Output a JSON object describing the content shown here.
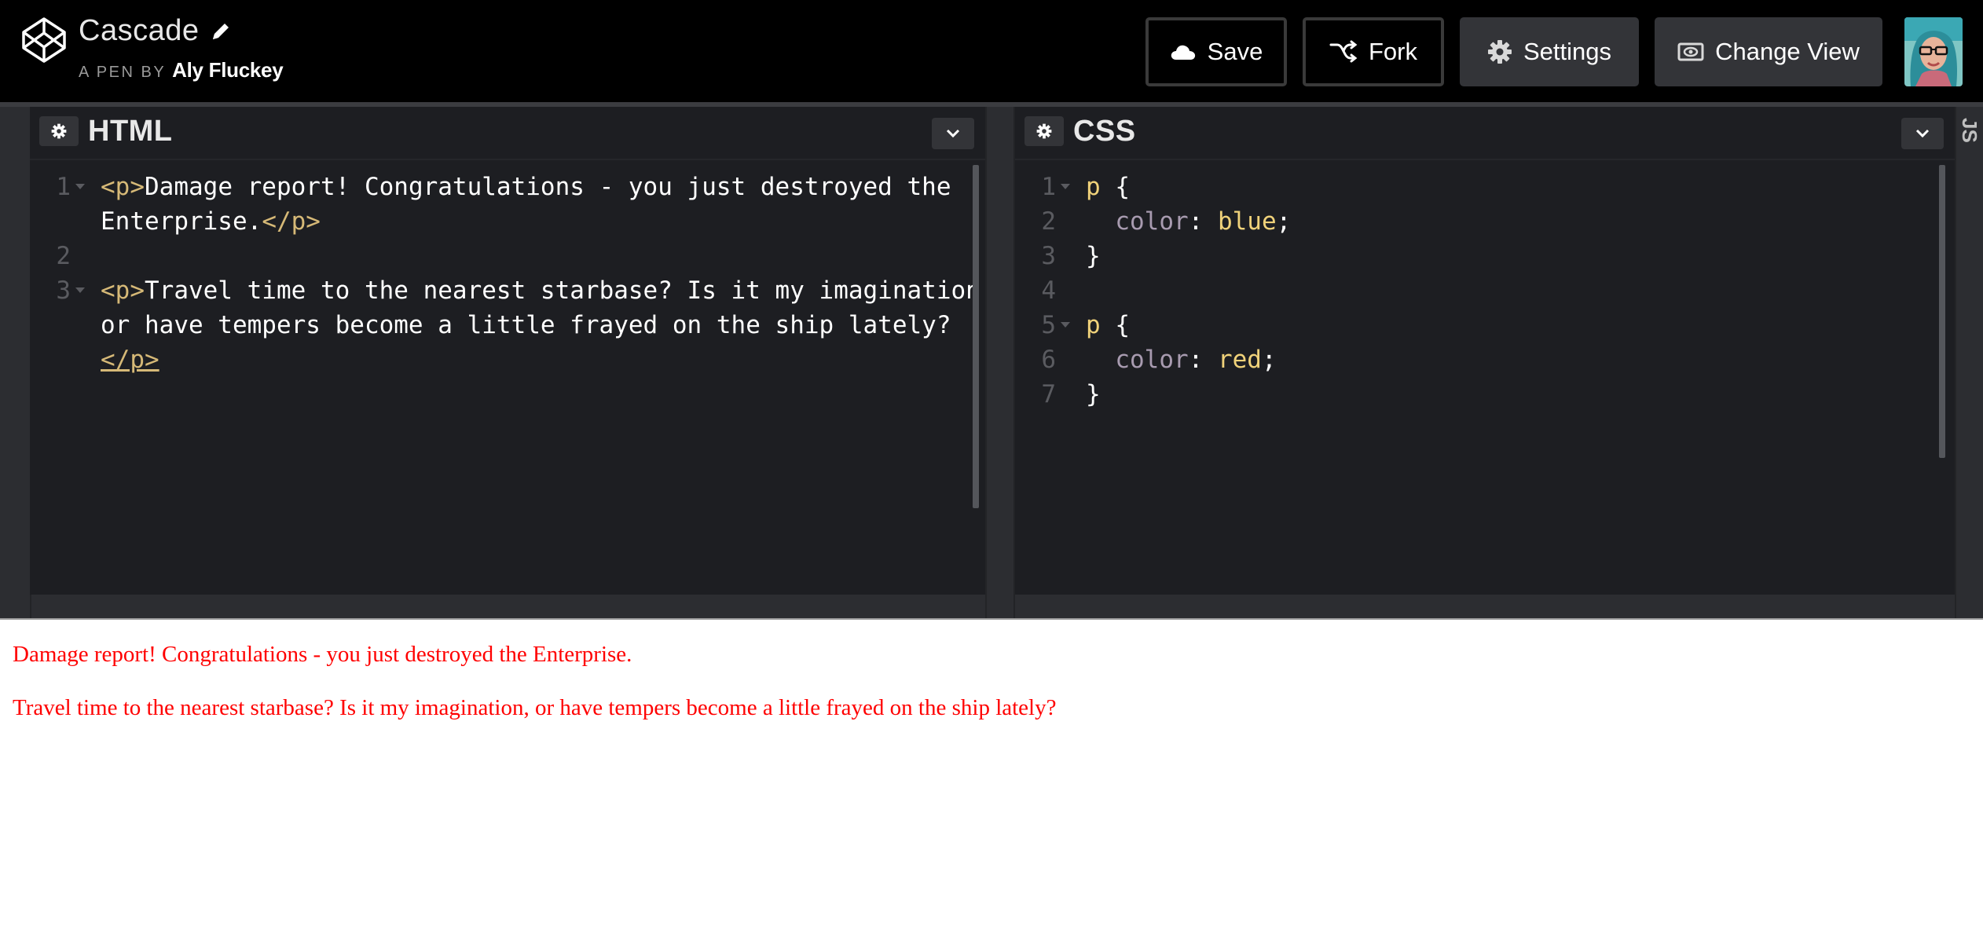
{
  "header": {
    "pen_title": "Cascade",
    "byline_prefix": "A PEN BY",
    "author": "Aly Fluckey",
    "buttons": {
      "save": "Save",
      "fork": "Fork",
      "settings": "Settings",
      "change_view": "Change View"
    },
    "icons": {
      "logo": "codepen-logo-icon",
      "edit": "pencil-icon",
      "save": "cloud-icon",
      "fork": "fork-icon",
      "settings": "gear-icon",
      "change_view": "eye-icon",
      "avatar": "user-avatar"
    }
  },
  "editors": {
    "html": {
      "title": "HTML",
      "lines": [
        {
          "num": "1",
          "parts": [
            {
              "t": "<p>",
              "c": "tag"
            },
            {
              "t": "Damage report! Congratulations - you just destroyed the",
              "c": "text"
            }
          ]
        },
        {
          "num": "",
          "parts": [
            {
              "t": "Enterprise.",
              "c": "text"
            },
            {
              "t": "</p>",
              "c": "tag"
            }
          ]
        },
        {
          "num": "2",
          "parts": []
        },
        {
          "num": "3",
          "parts": [
            {
              "t": "<p>",
              "c": "tag"
            },
            {
              "t": "Travel time to the nearest starbase? Is it my imagination,",
              "c": "text"
            }
          ]
        },
        {
          "num": "",
          "parts": [
            {
              "t": "or have tempers become a little frayed on the ship lately?",
              "c": "text"
            }
          ]
        },
        {
          "num": "",
          "parts": [
            {
              "t": "</p>",
              "c": "tag"
            }
          ]
        }
      ]
    },
    "css": {
      "title": "CSS",
      "lines": [
        {
          "num": "1",
          "parts": [
            {
              "t": "p",
              "c": "sel"
            },
            {
              "t": " {",
              "c": "punc"
            }
          ]
        },
        {
          "num": "2",
          "parts": [
            {
              "t": "  color",
              "c": "prop"
            },
            {
              "t": ": ",
              "c": "punc"
            },
            {
              "t": "blue",
              "c": "val"
            },
            {
              "t": ";",
              "c": "punc"
            }
          ]
        },
        {
          "num": "3",
          "parts": [
            {
              "t": "}",
              "c": "punc"
            }
          ]
        },
        {
          "num": "4",
          "parts": []
        },
        {
          "num": "5",
          "parts": [
            {
              "t": "p",
              "c": "sel"
            },
            {
              "t": " {",
              "c": "punc"
            }
          ]
        },
        {
          "num": "6",
          "parts": [
            {
              "t": "  color",
              "c": "prop"
            },
            {
              "t": ": ",
              "c": "punc"
            },
            {
              "t": "red",
              "c": "val"
            },
            {
              "t": ";",
              "c": "punc"
            }
          ]
        },
        {
          "num": "7",
          "parts": [
            {
              "t": "}",
              "c": "punc"
            }
          ]
        }
      ]
    },
    "js": {
      "title": "JS"
    }
  },
  "preview": {
    "paragraphs": [
      "Damage report! Congratulations - you just destroyed the Enterprise.",
      "Travel time to the nearest starbase? Is it my imagination, or have tempers become a little frayed on the ship lately?"
    ],
    "text_color": "#ff0000"
  },
  "colors": {
    "header_bg": "#000000",
    "editor_bg": "#1d1e22",
    "tag": "#d6b977",
    "value": "#f0d27a",
    "property": "#a89bb0"
  }
}
